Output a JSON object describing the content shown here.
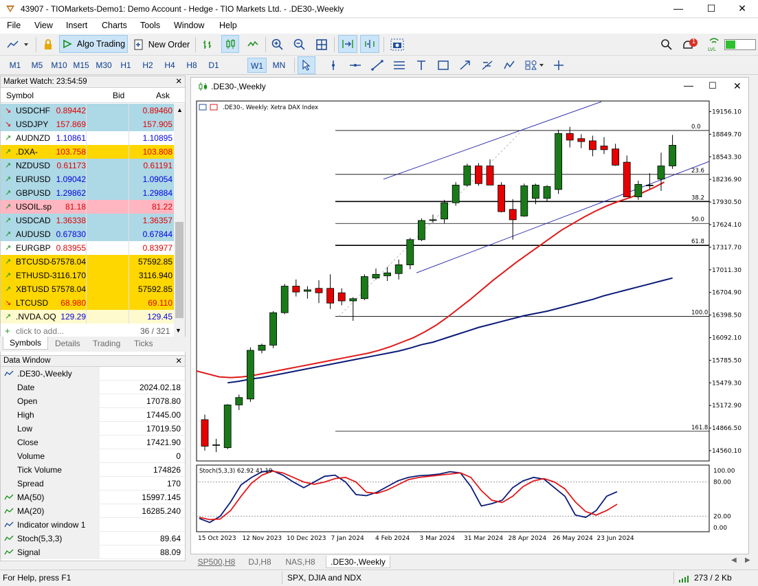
{
  "window": {
    "title": "43907 - TIOMarkets-Demo1: Demo Account - Hedge - TIO Markets Ltd. - .DE30-,Weekly"
  },
  "menu": [
    "File",
    "View",
    "Insert",
    "Charts",
    "Tools",
    "Window",
    "Help"
  ],
  "toolbar": {
    "algo_trading": "Algo Trading",
    "new_order": "New Order",
    "notif_count": "1"
  },
  "timeframes": [
    "M1",
    "M5",
    "M10",
    "M15",
    "M30",
    "H1",
    "H2",
    "H4",
    "H8",
    "D1",
    "W1",
    "MN"
  ],
  "selected_timeframe": "W1",
  "market_watch": {
    "title": "Market Watch: 23:54:59",
    "headers": {
      "symbol": "Symbol",
      "bid": "Bid",
      "ask": "Ask"
    },
    "rows": [
      {
        "symbol": "USDCHF",
        "bid": "0.89442",
        "ask": "0.89460",
        "dir": "down",
        "bg": "#add8e6",
        "color": "#e00000"
      },
      {
        "symbol": "USDJPY",
        "bid": "157.869",
        "ask": "157.905",
        "dir": "down",
        "bg": "#add8e6",
        "color": "#e00000"
      },
      {
        "symbol": "AUDNZD",
        "bid": "1.10861",
        "ask": "1.10895",
        "dir": "up",
        "bg": "#ffffff",
        "color": "#0000dd"
      },
      {
        "symbol": ".DXA-",
        "bid": "103.758",
        "ask": "103.808",
        "dir": "up",
        "bg": "#ffd700",
        "color": "#e00000"
      },
      {
        "symbol": "NZDUSD",
        "bid": "0.61173",
        "ask": "0.61191",
        "dir": "up",
        "bg": "#add8e6",
        "color": "#e00000"
      },
      {
        "symbol": "EURUSD",
        "bid": "1.09042",
        "ask": "1.09054",
        "dir": "up",
        "bg": "#add8e6",
        "color": "#0000dd"
      },
      {
        "symbol": "GBPUSD",
        "bid": "1.29862",
        "ask": "1.29884",
        "dir": "up",
        "bg": "#add8e6",
        "color": "#0000dd"
      },
      {
        "symbol": "USOIL.sp",
        "bid": "81.18",
        "ask": "81.22",
        "dir": "up",
        "bg": "#ffb6c1",
        "color": "#e00000"
      },
      {
        "symbol": "USDCAD",
        "bid": "1.36338",
        "ask": "1.36357",
        "dir": "up",
        "bg": "#add8e6",
        "color": "#e00000"
      },
      {
        "symbol": "AUDUSD",
        "bid": "0.67830",
        "ask": "0.67844",
        "dir": "up",
        "bg": "#add8e6",
        "color": "#0000dd"
      },
      {
        "symbol": "EURGBP",
        "bid": "0.83955",
        "ask": "0.83977",
        "dir": "up",
        "bg": "#ffffff",
        "color": "#e00000"
      },
      {
        "symbol": "BTCUSD-",
        "bid": "57578.04",
        "ask": "57592.85",
        "dir": "up",
        "bg": "#ffd700",
        "color": "#000000"
      },
      {
        "symbol": "ETHUSD-",
        "bid": "3116.170",
        "ask": "3116.940",
        "dir": "up",
        "bg": "#ffd700",
        "color": "#000000"
      },
      {
        "symbol": "XBTUSD",
        "bid": "57578.04",
        "ask": "57592.85",
        "dir": "up",
        "bg": "#ffd700",
        "color": "#000000"
      },
      {
        "symbol": "LTCUSD",
        "bid": "68.980",
        "ask": "69.110",
        "dir": "down",
        "bg": "#ffd700",
        "color": "#e00000"
      },
      {
        "symbol": ".NVDA.OQ",
        "bid": "129.29",
        "ask": "129.45",
        "dir": "up",
        "bg": "#fffacd",
        "color": "#0000dd"
      }
    ],
    "add_placeholder": "click to add...",
    "count": "36 / 321",
    "tabs": [
      "Symbols",
      "Details",
      "Trading",
      "Ticks"
    ]
  },
  "data_window": {
    "title": "Data Window",
    "header": ".DE30-,Weekly",
    "rows": [
      {
        "k": "Date",
        "v": "2024.02.18"
      },
      {
        "k": "Open",
        "v": "17078.80"
      },
      {
        "k": "High",
        "v": "17445.00"
      },
      {
        "k": "Low",
        "v": "17019.50"
      },
      {
        "k": "Close",
        "v": "17421.90"
      },
      {
        "k": "Volume",
        "v": "0"
      },
      {
        "k": "Tick Volume",
        "v": "174826"
      },
      {
        "k": "Spread",
        "v": "170"
      },
      {
        "k": "MA(50)",
        "v": "15997.145"
      },
      {
        "k": "MA(20)",
        "v": "16285.240"
      },
      {
        "k": "Indicator window 1",
        "v": ""
      },
      {
        "k": "Stoch(5,3,3)",
        "v": "89.64"
      },
      {
        "k": "Signal",
        "v": "88.09"
      }
    ]
  },
  "chart": {
    "window_title": ".DE30-,Weekly",
    "label": ".DE30-, Weekly:  Xetra DAX Index",
    "stoch_label": "Stoch(5,3,3) 62.92 41.19",
    "price_ticks": [
      "19156.10",
      "18849.70",
      "18543.30",
      "18236.90",
      "17930.50",
      "17624.10",
      "17317.70",
      "17011.30",
      "16704.90",
      "16398.50",
      "16092.10",
      "15785.50",
      "15479.30",
      "15172.90",
      "14866.50",
      "14560.10"
    ],
    "stoch_ticks": [
      "100.00",
      "80.00",
      "20.00",
      "0.00"
    ],
    "date_ticks": [
      "15 Oct 2023",
      "12 Nov 2023",
      "10 Dec 2023",
      "7 Jan 2024",
      "4 Feb 2024",
      "3 Mar 2024",
      "31 Mar 2024",
      "28 Apr 2024",
      "26 May 2024",
      "23 Jun 2024"
    ],
    "fib_labels": [
      "0.0",
      "23.6",
      "38.2",
      "50.0",
      "61.8",
      "100.0",
      "161.8"
    ]
  },
  "chart_data": {
    "type": "candlestick",
    "title": ".DE30-, Weekly:  Xetra DAX Index",
    "ylim": [
      14420,
      19300
    ],
    "candles": [
      {
        "o": 14980,
        "h": 15050,
        "l": 14560,
        "c": 14620
      },
      {
        "o": 14640,
        "h": 14720,
        "l": 14540,
        "c": 14640
      },
      {
        "o": 14600,
        "h": 15190,
        "l": 14580,
        "c": 15180
      },
      {
        "o": 15180,
        "h": 15320,
        "l": 15110,
        "c": 15280
      },
      {
        "o": 15260,
        "h": 15960,
        "l": 15220,
        "c": 15920
      },
      {
        "o": 15920,
        "h": 16010,
        "l": 15880,
        "c": 15990
      },
      {
        "o": 15990,
        "h": 16450,
        "l": 15950,
        "c": 16430
      },
      {
        "o": 16430,
        "h": 16820,
        "l": 16410,
        "c": 16790
      },
      {
        "o": 16790,
        "h": 16880,
        "l": 16650,
        "c": 16710
      },
      {
        "o": 16720,
        "h": 16790,
        "l": 16620,
        "c": 16740
      },
      {
        "o": 16760,
        "h": 16870,
        "l": 16560,
        "c": 16700
      },
      {
        "o": 16760,
        "h": 16950,
        "l": 16480,
        "c": 16560
      },
      {
        "o": 16700,
        "h": 16760,
        "l": 16530,
        "c": 16590
      },
      {
        "o": 16590,
        "h": 16640,
        "l": 16320,
        "c": 16620
      },
      {
        "o": 16620,
        "h": 16950,
        "l": 16600,
        "c": 16920
      },
      {
        "o": 16900,
        "h": 17030,
        "l": 16880,
        "c": 16950
      },
      {
        "o": 16930,
        "h": 17050,
        "l": 16860,
        "c": 16970
      },
      {
        "o": 16960,
        "h": 17150,
        "l": 16880,
        "c": 17080
      },
      {
        "o": 17078,
        "h": 17445,
        "l": 17019,
        "c": 17421
      },
      {
        "o": 17420,
        "h": 17710,
        "l": 17400,
        "c": 17680
      },
      {
        "o": 17680,
        "h": 17760,
        "l": 17650,
        "c": 17690
      },
      {
        "o": 17700,
        "h": 17960,
        "l": 17640,
        "c": 17920
      },
      {
        "o": 17920,
        "h": 18200,
        "l": 17880,
        "c": 18160
      },
      {
        "o": 18160,
        "h": 18450,
        "l": 18140,
        "c": 18420
      },
      {
        "o": 18420,
        "h": 18460,
        "l": 18150,
        "c": 18180
      },
      {
        "o": 18420,
        "h": 18510,
        "l": 18160,
        "c": 18160
      },
      {
        "o": 18160,
        "h": 18200,
        "l": 17790,
        "c": 17800
      },
      {
        "o": 17830,
        "h": 17970,
        "l": 17420,
        "c": 17690
      },
      {
        "o": 17740,
        "h": 18180,
        "l": 17730,
        "c": 18150
      },
      {
        "o": 17980,
        "h": 18180,
        "l": 17900,
        "c": 18160
      },
      {
        "o": 17980,
        "h": 18160,
        "l": 17940,
        "c": 18140
      },
      {
        "o": 18100,
        "h": 18910,
        "l": 18040,
        "c": 18860
      },
      {
        "o": 18860,
        "h": 18950,
        "l": 18670,
        "c": 18770
      },
      {
        "o": 18790,
        "h": 18850,
        "l": 18660,
        "c": 18750
      },
      {
        "o": 18760,
        "h": 18830,
        "l": 18550,
        "c": 18640
      },
      {
        "o": 18690,
        "h": 18810,
        "l": 18580,
        "c": 18640
      },
      {
        "o": 18650,
        "h": 18720,
        "l": 18420,
        "c": 18430
      },
      {
        "o": 18470,
        "h": 18560,
        "l": 18070,
        "c": 18000
      },
      {
        "o": 18000,
        "h": 18220,
        "l": 17960,
        "c": 18170
      },
      {
        "o": 18150,
        "h": 18320,
        "l": 18110,
        "c": 18160
      },
      {
        "o": 18240,
        "h": 18600,
        "l": 18080,
        "c": 18420
      },
      {
        "o": 18420,
        "h": 18840,
        "l": 18380,
        "c": 18700
      }
    ],
    "ma20_start_index": 0,
    "ma20": [
      15640,
      15600,
      15560,
      15550,
      15560,
      15580,
      15610,
      15640,
      15670,
      15700,
      15730,
      15760,
      15790,
      15820,
      15850,
      15880,
      15920,
      15970,
      16030,
      16090,
      16170,
      16260,
      16370,
      16490,
      16610,
      16740,
      16870,
      16990,
      17110,
      17220,
      17330,
      17440,
      17550,
      17640,
      17730,
      17810,
      17880,
      17940,
      17990,
      18050,
      18120,
      18200
    ],
    "ma50_start_index": 2,
    "ma50": [
      15480,
      15500,
      15530,
      15550,
      15580,
      15610,
      15640,
      15670,
      15700,
      15730,
      15760,
      15790,
      15820,
      15850,
      15880,
      15910,
      15950,
      15997,
      16030,
      16080,
      16130,
      16180,
      16230,
      16270,
      16310,
      16350,
      16390,
      16420,
      16450,
      16490,
      16530,
      16570,
      16610,
      16660,
      16700,
      16740,
      16780,
      16820,
      16860,
      16900
    ],
    "stoch_main": [
      16,
      9,
      20,
      45,
      75,
      88,
      98,
      100,
      92,
      80,
      70,
      80,
      90,
      92,
      80,
      58,
      56,
      62,
      72,
      82,
      88,
      91,
      92,
      94,
      98,
      96,
      72,
      38,
      42,
      48,
      70,
      82,
      88,
      85,
      70,
      55,
      22,
      18,
      30,
      55,
      63
    ],
    "stoch_signal": [
      18,
      14,
      15,
      30,
      55,
      78,
      92,
      99,
      96,
      88,
      80,
      76,
      80,
      86,
      88,
      80,
      62,
      60,
      66,
      75,
      84,
      88,
      90,
      92,
      94,
      96,
      88,
      65,
      48,
      44,
      55,
      72,
      82,
      86,
      80,
      68,
      45,
      28,
      22,
      30,
      41
    ]
  }
}
